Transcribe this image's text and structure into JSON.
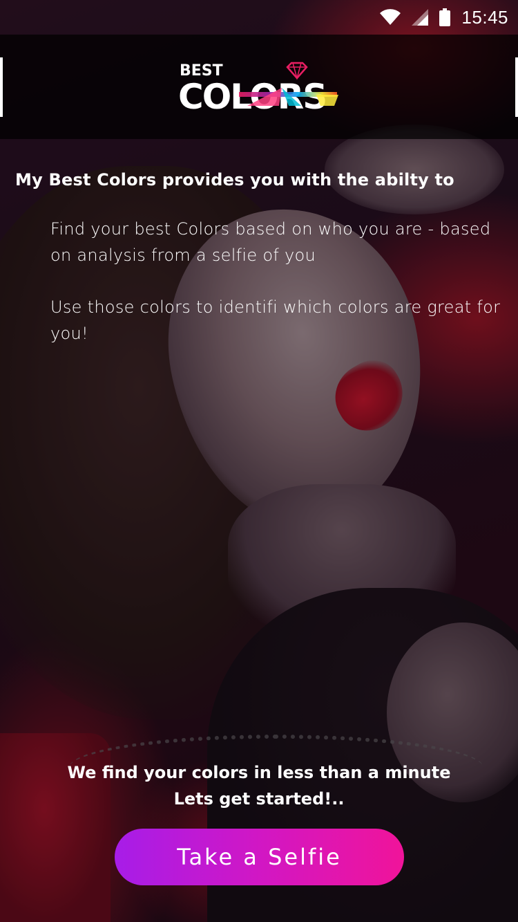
{
  "status_bar": {
    "time": "15:45",
    "icons": [
      "wifi-icon",
      "cellular-signal-icon",
      "battery-icon"
    ]
  },
  "header": {
    "logo": {
      "top_text": "BEST",
      "main_text": "COLORS",
      "icon": "diamond-icon"
    }
  },
  "intro": {
    "title": "My Best Colors provides you with the abilty to",
    "points": [
      "Find your best Colors based on who you are - based on analysis from a selfie of you",
      "Use those colors to identifi which colors are great for you!"
    ]
  },
  "cta": {
    "line1": "We find your colors in less than a minute",
    "line2": "Lets get started!..",
    "button_label": "Take a Selfie"
  },
  "colors": {
    "button_gradient_start": "#a71de8",
    "button_gradient_end": "#f0149a",
    "header_background": "#000000"
  }
}
